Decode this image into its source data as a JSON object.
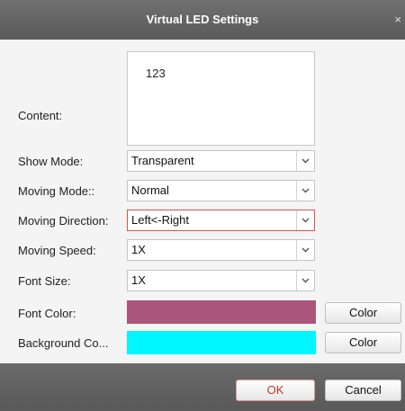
{
  "dialog": {
    "title": "Virtual LED Settings",
    "close_symbol": "×"
  },
  "fields": {
    "content_label": "Content:",
    "content_value": "123",
    "show_mode_label": "Show Mode:",
    "show_mode_value": "Transparent",
    "moving_mode_label": "Moving Mode::",
    "moving_mode_value": "Normal",
    "moving_direction_label": "Moving Direction:",
    "moving_direction_value": "Left<-Right",
    "moving_speed_label": "Moving Speed:",
    "moving_speed_value": "1X",
    "font_size_label": "Font Size:",
    "font_size_value": "1X",
    "font_color_label": "Font Color:",
    "font_color_value": "#a9557c",
    "background_color_label": "Background Co...",
    "background_color_value": "#00f6ff",
    "color_button_label": "Color"
  },
  "footer": {
    "ok_label": "OK",
    "cancel_label": "Cancel"
  },
  "colors": {
    "title_bar": "#626262",
    "ok_text": "#c0392b",
    "active_border": "#d9534f"
  }
}
